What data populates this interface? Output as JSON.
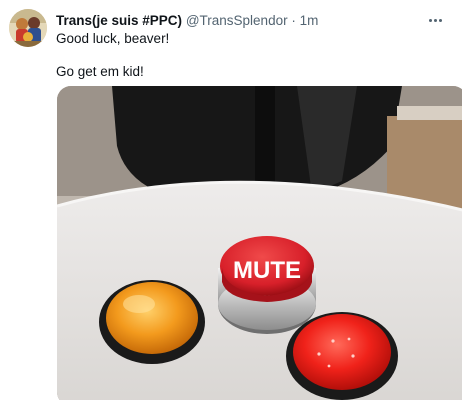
{
  "tweet": {
    "display_name": "Trans(je suis #PPC)",
    "handle": "@TransSplendor",
    "separator": "·",
    "time": "1m",
    "lines": [
      "Good luck, beaver!",
      "Go get em kid!"
    ]
  },
  "media": {
    "button_label": "MUTE",
    "button_colors": {
      "orange": "#f39a1d",
      "mute": "#d8202a",
      "red": "#f0221a"
    }
  },
  "icons": {
    "more": "more-dots-icon",
    "avatar": "avatar-image"
  }
}
